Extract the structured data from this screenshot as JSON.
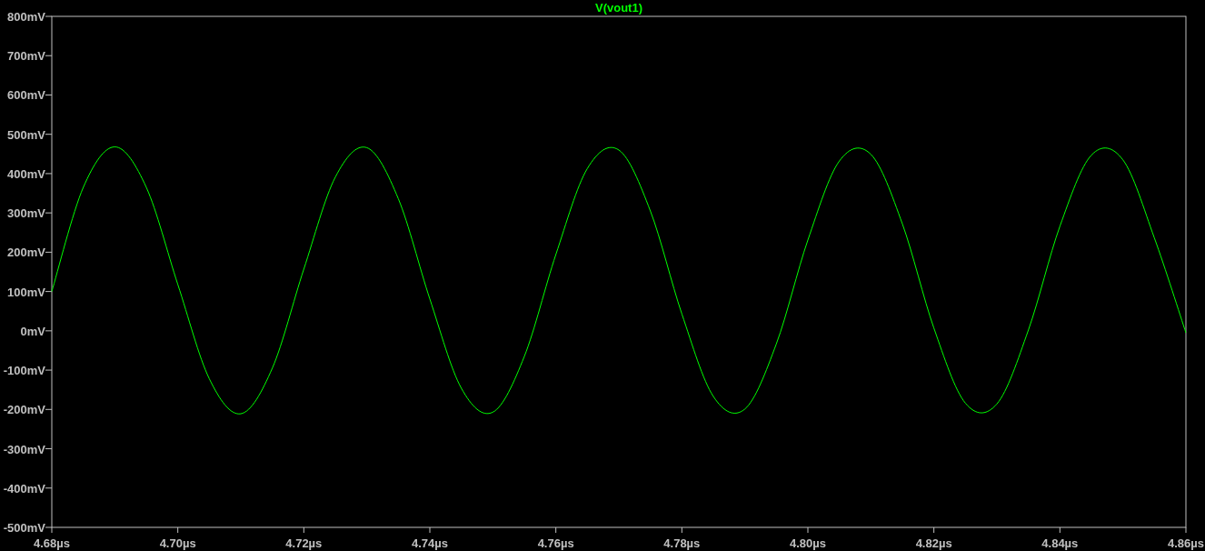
{
  "waveform_plot": {
    "chart_data": {
      "type": "line",
      "title": "V(vout1)",
      "x": [
        4.68,
        4.685,
        4.69,
        4.695,
        4.7,
        4.705,
        4.71,
        4.715,
        4.72,
        4.725,
        4.73,
        4.735,
        4.74,
        4.745,
        4.75,
        4.755,
        4.76,
        4.765,
        4.77,
        4.775,
        4.78,
        4.785,
        4.79,
        4.795,
        4.8,
        4.805,
        4.81,
        4.815,
        4.82,
        4.825,
        4.83,
        4.835,
        4.84,
        4.845,
        4.85,
        4.855,
        4.86
      ],
      "series": [
        {
          "color": "#00ff00",
          "values": [
            100,
            365,
            468,
            365,
            118,
            -122,
            -211,
            -95,
            157,
            391,
            466,
            336,
            81,
            -146,
            -207,
            -65,
            194,
            413,
            460,
            305,
            43,
            -167,
            -199,
            -33,
            231,
            432,
            449,
            272,
            7,
            -184,
            -186,
            2,
            266,
            447,
            435,
            236,
            -5
          ]
        }
      ],
      "xlim": [
        4.68,
        4.86
      ],
      "ylim": [
        -500,
        800
      ],
      "xticks": [
        {
          "value": 4.68,
          "label": "4.68µs"
        },
        {
          "value": 4.7,
          "label": "4.70µs"
        },
        {
          "value": 4.72,
          "label": "4.72µs"
        },
        {
          "value": 4.74,
          "label": "4.74µs"
        },
        {
          "value": 4.76,
          "label": "4.76µs"
        },
        {
          "value": 4.78,
          "label": "4.78µs"
        },
        {
          "value": 4.8,
          "label": "4.80µs"
        },
        {
          "value": 4.82,
          "label": "4.82µs"
        },
        {
          "value": 4.84,
          "label": "4.84µs"
        },
        {
          "value": 4.86,
          "label": "4.86µs"
        }
      ],
      "yticks": [
        {
          "value": 800,
          "label": "800mV"
        },
        {
          "value": 700,
          "label": "700mV"
        },
        {
          "value": 600,
          "label": "600mV"
        },
        {
          "value": 500,
          "label": "500mV"
        },
        {
          "value": 400,
          "label": "400mV"
        },
        {
          "value": 300,
          "label": "300mV"
        },
        {
          "value": 200,
          "label": "200mV"
        },
        {
          "value": 100,
          "label": "100mV"
        },
        {
          "value": 0,
          "label": "0mV"
        },
        {
          "value": -100,
          "label": "-100mV"
        },
        {
          "value": -200,
          "label": "-200mV"
        },
        {
          "value": -300,
          "label": "-300mV"
        },
        {
          "value": -400,
          "label": "-400mV"
        },
        {
          "value": -500,
          "label": "-500mV"
        }
      ]
    }
  }
}
